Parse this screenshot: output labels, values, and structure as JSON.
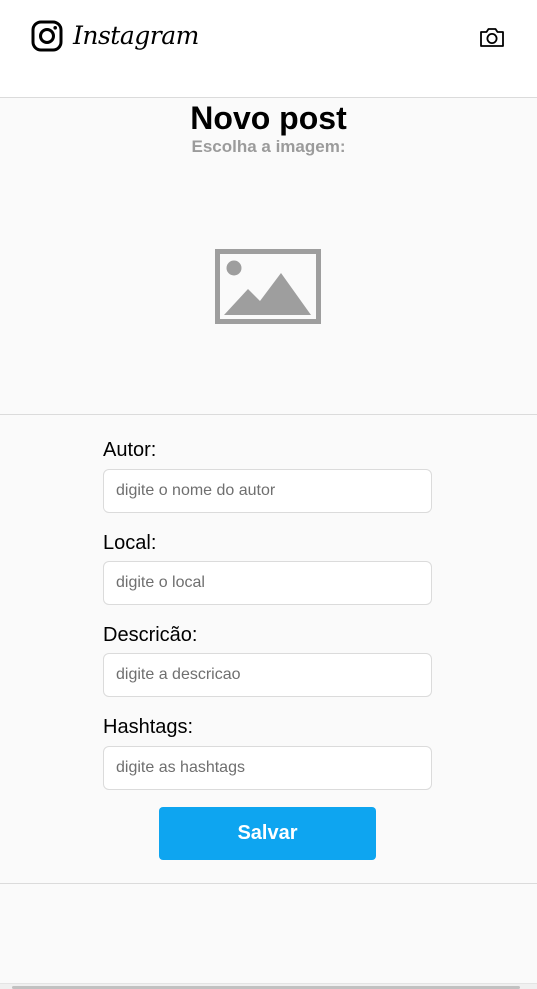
{
  "header": {
    "brand": "Instagram",
    "logo_icon": "instagram-logo-icon",
    "camera_icon": "camera-icon"
  },
  "page": {
    "title": "Novo post",
    "subtitle": "Escolha a imagem:",
    "image_placeholder_icon": "image-placeholder-icon"
  },
  "form": {
    "fields": [
      {
        "label": "Autor:",
        "placeholder": "digite o nome do autor",
        "value": ""
      },
      {
        "label": "Local:",
        "placeholder": "digite o local",
        "value": ""
      },
      {
        "label": "Descricão:",
        "placeholder": "digite a descricao",
        "value": ""
      },
      {
        "label": "Hashtags:",
        "placeholder": "digite as hashtags",
        "value": ""
      }
    ],
    "save_label": "Salvar"
  },
  "colors": {
    "accent": "#0ea5f0",
    "background": "#fafafa",
    "border": "#dbdbdb",
    "muted_text": "#9b9b9b"
  }
}
